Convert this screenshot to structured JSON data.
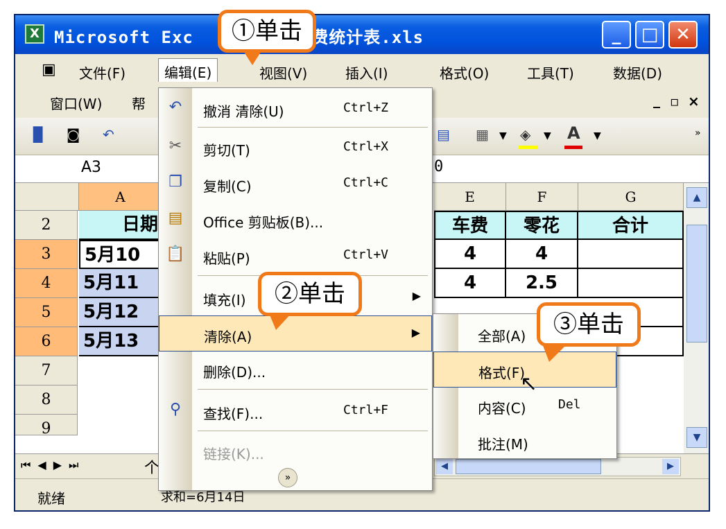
{
  "window": {
    "app_icon": "excel-icon",
    "title": "Microsoft Excel - 个人消费统计表.xls",
    "title_visible_left": "Microsoft Exc",
    "title_visible_right": ".消费统计表.xls",
    "buttons": [
      "minimize",
      "maximize",
      "close"
    ]
  },
  "menubar": {
    "row1": [
      "文件(F)",
      "编辑(E)",
      "视图(V)",
      "插入(I)",
      "格式(O)",
      "工具(T)",
      "数据(D)"
    ],
    "row2": [
      "窗口(W)",
      "帮"
    ],
    "doc_controls": [
      "_",
      "▫",
      "×"
    ]
  },
  "namebox": {
    "value": "A3",
    "formula_value": "0"
  },
  "columns": [
    "A",
    "E",
    "F",
    "G"
  ],
  "rows": [
    "2",
    "3",
    "4",
    "5",
    "6",
    "7",
    "8",
    "9"
  ],
  "table": {
    "header_a": "日期",
    "header_e": "车费",
    "header_f": "零花",
    "header_g": "合计",
    "a_values": [
      "5月10",
      "5月11",
      "5月12",
      "5月13"
    ],
    "e_values": [
      "4",
      "4"
    ],
    "f_values": [
      "4",
      "2.5"
    ]
  },
  "sheet_tab_partial": "个",
  "status": {
    "ready": "就绪",
    "sum": "求和=6月14日"
  },
  "edit_menu": {
    "items": [
      {
        "icon": "undo-icon",
        "label": "撤消 清除(U)",
        "shortcut": "Ctrl+Z"
      },
      {
        "icon": "cut-icon",
        "label": "剪切(T)",
        "shortcut": "Ctrl+X"
      },
      {
        "icon": "copy-icon",
        "label": "复制(C)",
        "shortcut": "Ctrl+C"
      },
      {
        "icon": "clipboard-icon",
        "label": "Office 剪贴板(B)...",
        "shortcut": ""
      },
      {
        "icon": "paste-icon",
        "label": "粘贴(P)",
        "shortcut": "Ctrl+V"
      },
      {
        "icon": "",
        "label": "填充(I)",
        "shortcut": ""
      },
      {
        "icon": "",
        "label": "清除(A)",
        "shortcut": ""
      },
      {
        "icon": "",
        "label": "删除(D)...",
        "shortcut": ""
      },
      {
        "icon": "find-icon",
        "label": "查找(F)...",
        "shortcut": "Ctrl+F"
      },
      {
        "icon": "",
        "label": "链接(K)...",
        "shortcut": ""
      }
    ],
    "expand": "»"
  },
  "clear_submenu": {
    "items": [
      {
        "label": "全部(A)",
        "shortcut": ""
      },
      {
        "label": "格式(F)",
        "shortcut": ""
      },
      {
        "label": "内容(C)",
        "shortcut": "Del"
      },
      {
        "label": "批注(M)",
        "shortcut": ""
      }
    ]
  },
  "callouts": [
    "①单击",
    "②单击",
    "③单击"
  ],
  "colors": {
    "accent": "#f07a1a",
    "highlight": "#ffe8b8",
    "header_cyan": "#c8f5f5",
    "date_fill": "#c8d4f0"
  }
}
